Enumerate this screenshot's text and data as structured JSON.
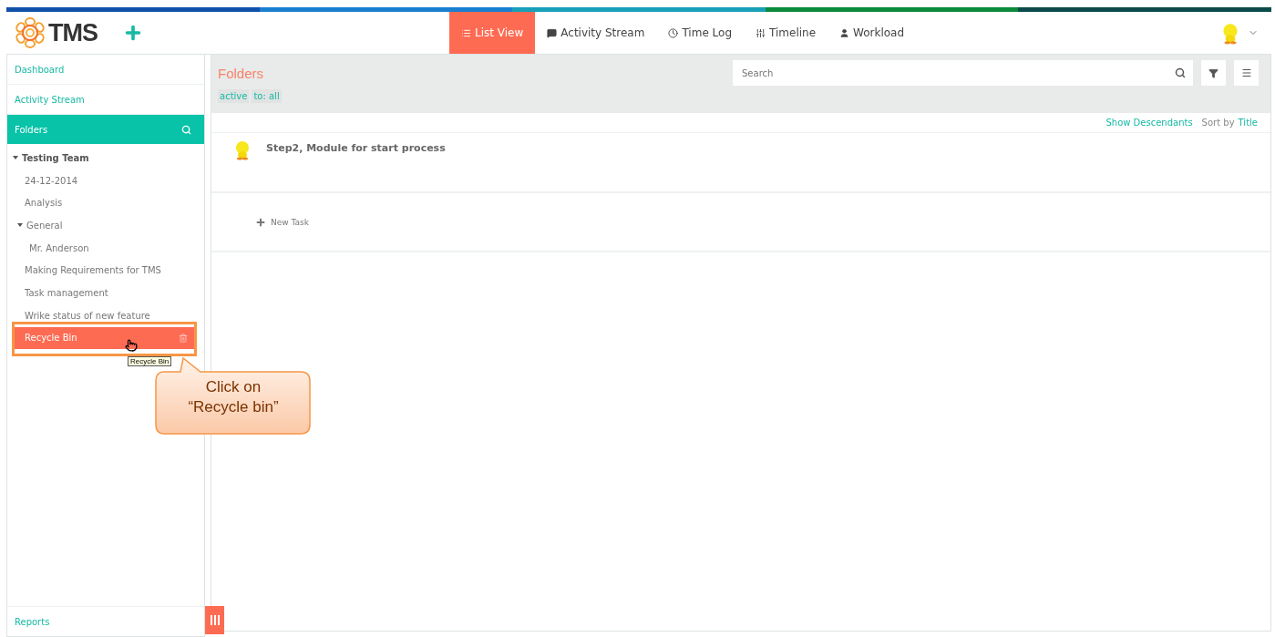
{
  "header": {
    "logo": "TMS",
    "tabs": [
      {
        "label": "List View",
        "selected": true
      },
      {
        "label": "Activity Stream",
        "selected": false
      },
      {
        "label": "Time Log",
        "selected": false
      },
      {
        "label": "Timeline",
        "selected": false
      },
      {
        "label": "Workload",
        "selected": false
      }
    ]
  },
  "sidebar": {
    "links": [
      "Dashboard",
      "Activity Stream"
    ],
    "folders_title": "Folders",
    "tree": [
      {
        "label": "Testing Team",
        "expanded": true,
        "selected": false,
        "children": [
          {
            "label": "24-12-2014",
            "selected": false
          },
          {
            "label": "Analysis",
            "selected": false
          },
          {
            "label": "General",
            "expanded": true,
            "selected": false,
            "children": [
              {
                "label": "Mr. Anderson",
                "selected": false
              }
            ]
          },
          {
            "label": "Making Requirements for TMS",
            "selected": false
          },
          {
            "label": "Task management",
            "selected": false
          },
          {
            "label": "Wrike status of new feature",
            "selected": false
          },
          {
            "label": "Recycle Bin",
            "selected": true
          }
        ]
      }
    ],
    "footer_link": "Reports"
  },
  "content": {
    "title": "Folders",
    "search": {
      "placeholder": "Search"
    },
    "filters": [
      "active",
      "to: all"
    ],
    "show_descendants": "Show Descendants",
    "sort_label": "Sort by",
    "sort_value": "Title",
    "tasks": [
      {
        "title": "Step2, Module for start process"
      }
    ],
    "new_task": "New Task"
  },
  "annotation": {
    "tooltip": "Recycle Bin",
    "callout": "Click on “Recycle bin”"
  }
}
